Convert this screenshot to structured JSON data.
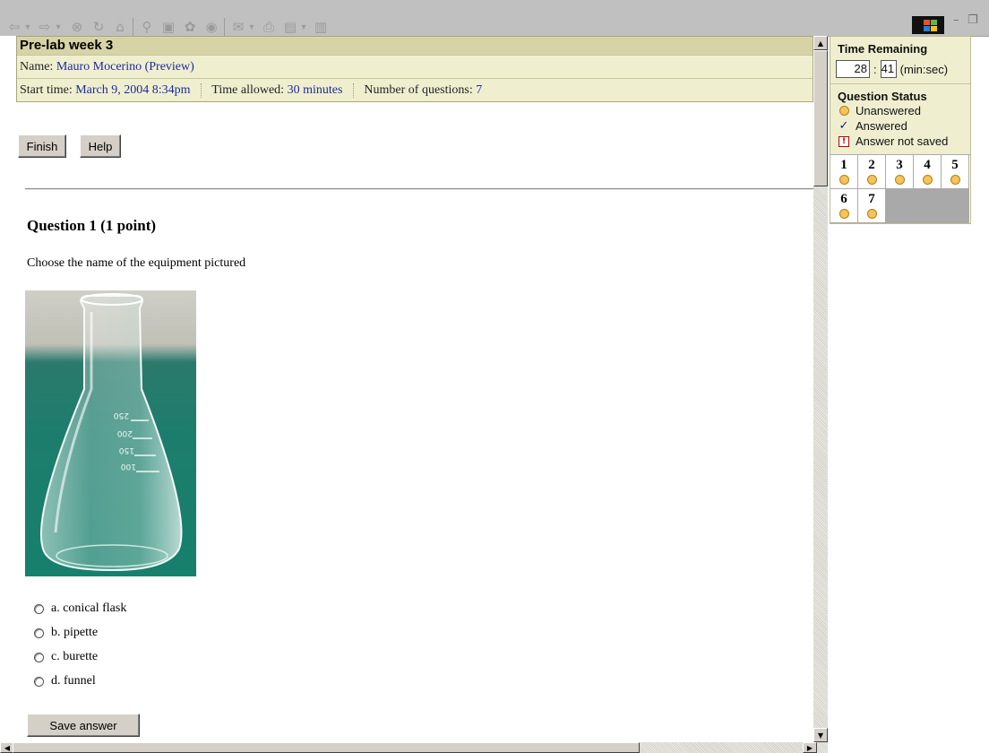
{
  "browser": {
    "toolbar_icons": [
      "back-icon",
      "back-dropdown-icon",
      "forward-icon",
      "forward-dropdown-icon",
      "stop-icon",
      "refresh-icon",
      "home-icon",
      "search-icon",
      "favorites-icon",
      "history-icon",
      "media-icon",
      "mail-icon",
      "mail-dropdown-icon",
      "print-icon",
      "edit-icon",
      "edit-dropdown-icon",
      "discuss-icon"
    ],
    "window_controls": [
      "minimize",
      "restore"
    ]
  },
  "quiz": {
    "title": "Pre-lab week 3",
    "name_label": "Name:",
    "name_value": "Mauro Mocerino (Preview)",
    "start_label": "Start time:",
    "start_value": "March 9, 2004 8:34pm",
    "allowed_label": "Time allowed:",
    "allowed_value": "30 minutes",
    "numq_label": "Number of questions:",
    "numq_value": "7",
    "finish_label": "Finish",
    "help_label": "Help"
  },
  "question": {
    "title": "Question 1  (1 point)",
    "text": "Choose the name of the equipment pictured",
    "image_marks": [
      "250",
      "200",
      "150",
      "100"
    ],
    "options": [
      {
        "label": "a.  conical flask"
      },
      {
        "label": "b.  pipette"
      },
      {
        "label": "c.  burette"
      },
      {
        "label": "d.  funnel"
      }
    ],
    "save_label": "Save answer"
  },
  "side": {
    "time_title": "Time Remaining",
    "minutes": "28",
    "colon": ":",
    "seconds": "41",
    "units": "(min:sec)",
    "status_title": "Question Status",
    "legend": [
      {
        "icon": "unanswered-dot-icon",
        "label": "Unanswered"
      },
      {
        "icon": "check-icon",
        "label": "Answered"
      },
      {
        "icon": "warning-icon",
        "label": "Answer not saved"
      }
    ],
    "questions": [
      "1",
      "2",
      "3",
      "4",
      "5",
      "6",
      "7"
    ]
  }
}
